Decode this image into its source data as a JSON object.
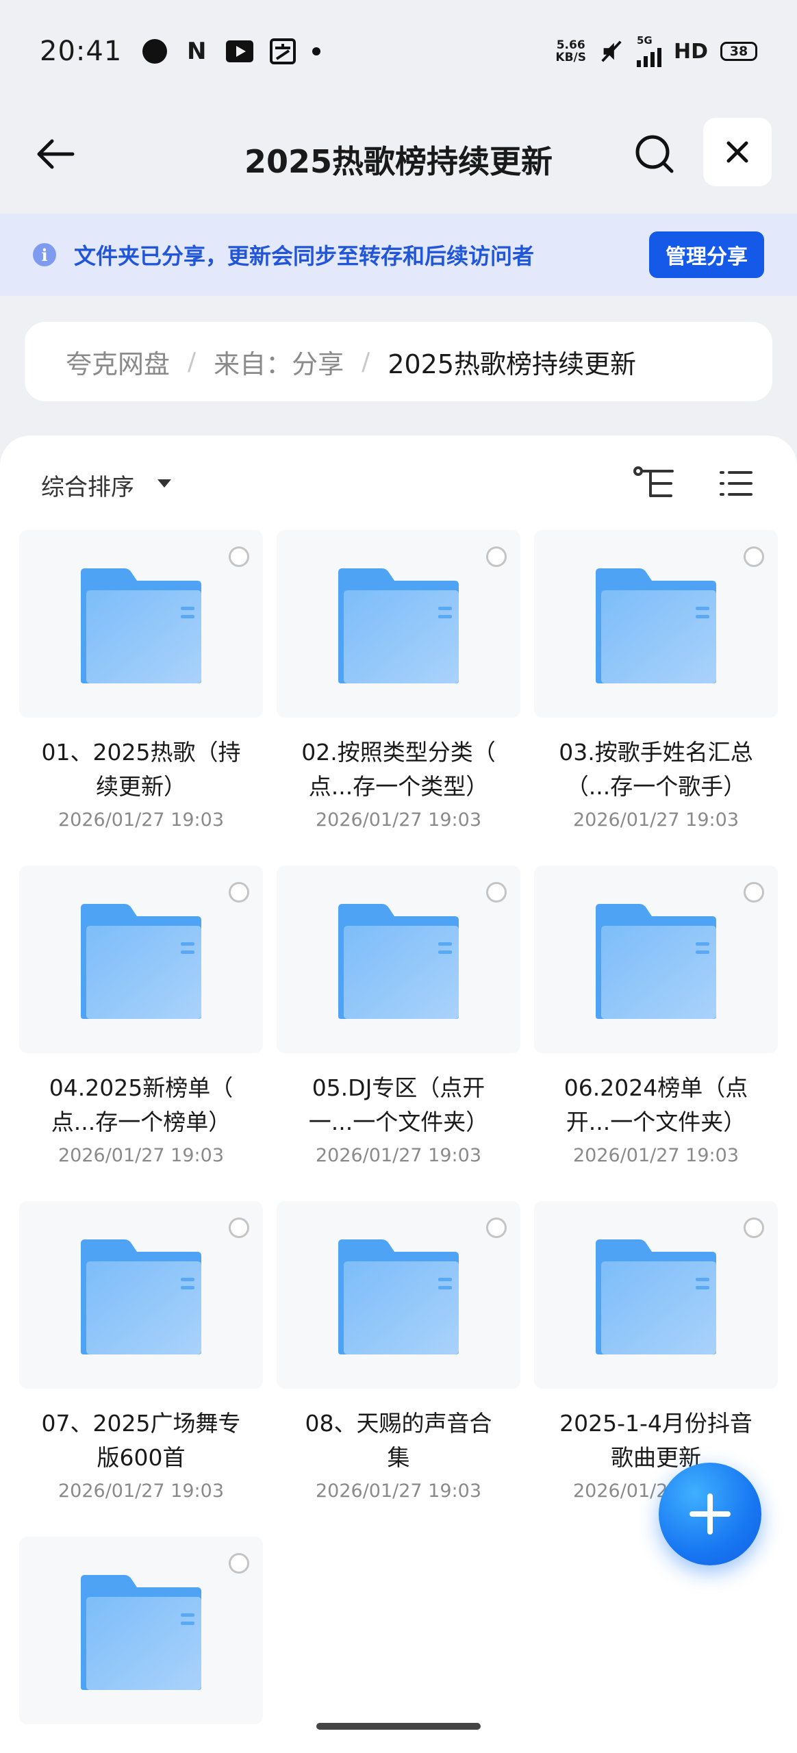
{
  "status_bar": {
    "time": "20:41",
    "net_speed_value": "5.66",
    "net_speed_unit": "KB/S",
    "network": "5G",
    "hd": "HD",
    "battery": "38",
    "app_icons": [
      "circle-app-icon",
      "n-app-icon",
      "youtube-icon",
      "alipay-icon"
    ]
  },
  "header": {
    "title": "2025热歌榜持续更新"
  },
  "banner": {
    "message": "文件夹已分享，更新会同步至转存和后续访问者",
    "manage_label": "管理分享"
  },
  "breadcrumb": {
    "items": [
      "夸克网盘",
      "来自：分享",
      "2025热歌榜持续更新"
    ]
  },
  "toolbar": {
    "sort_label": "综合排序"
  },
  "files": [
    {
      "name_line1": "01、2025热歌（持",
      "name_line2": "续更新）",
      "date": "2026/01/27 19:03"
    },
    {
      "name_line1": "02.按照类型分类（",
      "name_line2": "点...存一个类型）",
      "date": "2026/01/27 19:03"
    },
    {
      "name_line1": "03.按歌手姓名汇总",
      "name_line2": "（...存一个歌手）",
      "date": "2026/01/27 19:03"
    },
    {
      "name_line1": "04.2025新榜单（",
      "name_line2": "点...存一个榜单）",
      "date": "2026/01/27 19:03"
    },
    {
      "name_line1": "05.DJ专区（点开",
      "name_line2": "一...一个文件夹）",
      "date": "2026/01/27 19:03"
    },
    {
      "name_line1": "06.2024榜单（点",
      "name_line2": "开...一个文件夹）",
      "date": "2026/01/27 19:03"
    },
    {
      "name_line1": "07、2025广场舞专",
      "name_line2": "版600首",
      "date": "2026/01/27 19:03"
    },
    {
      "name_line1": "08、天赐的声音合",
      "name_line2": "集",
      "date": "2026/01/27 19:03"
    },
    {
      "name_line1": "2025-1-4月份抖音",
      "name_line2": "歌曲更新",
      "date": "2026/01/27 19:03"
    },
    {
      "name_line1": "",
      "name_line2": "",
      "date": ""
    }
  ],
  "colors": {
    "accent": "#1559e8",
    "banner_bg": "#e3e8fa",
    "folder": "#5aa9f5"
  }
}
